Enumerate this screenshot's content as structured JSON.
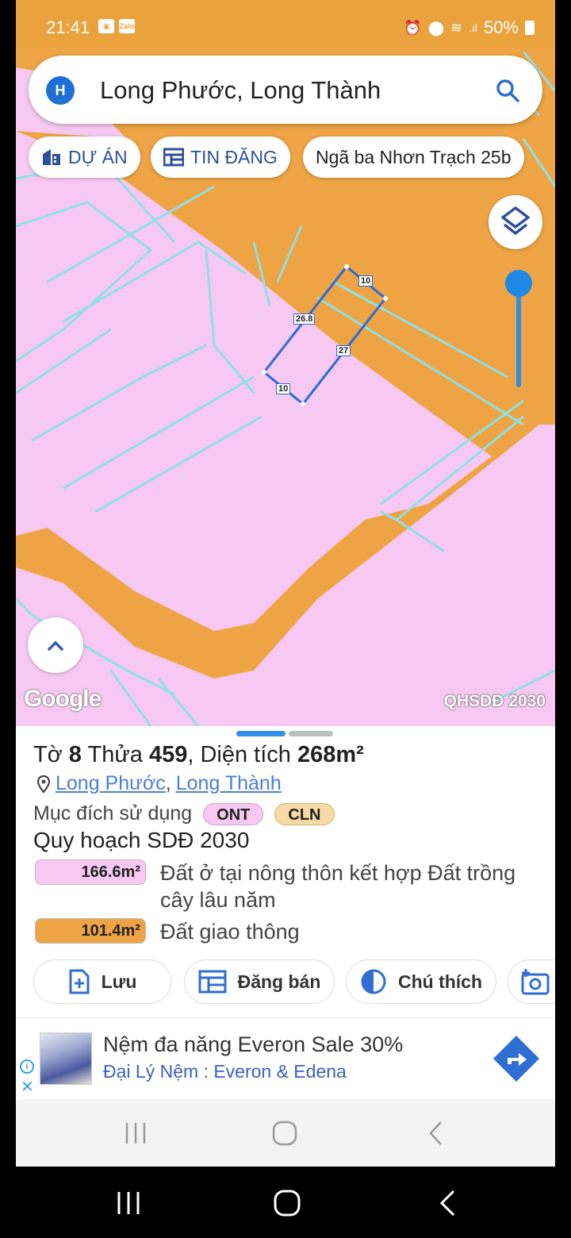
{
  "status_bar": {
    "time": "21:41",
    "battery": "50%",
    "zalo_badge": "Zalo"
  },
  "search": {
    "logo_letter": "H",
    "text": "Long Phước, Long Thành"
  },
  "chips": [
    {
      "label": "DỰ ÁN",
      "icon": "building-icon"
    },
    {
      "label": "TIN ĐĂNG",
      "icon": "listing-icon"
    },
    {
      "label": "Ngã ba Nhơn Trạch 25b"
    }
  ],
  "map": {
    "parcel_dimensions": [
      "10",
      "26.8",
      "27",
      "10"
    ],
    "attribution": "Google",
    "source_label": "QHSDĐ 2030",
    "colors": {
      "residential": "#f7c9f2",
      "transport": "#eea445",
      "boundary": "#8fe0e4",
      "parcel": "#2a6bd6"
    }
  },
  "parcel": {
    "title_prefix": "Tờ",
    "sheet_no": "8",
    "lot_label": "Thửa",
    "lot_no": "459",
    "area_label": ", Diện tích",
    "area": "268m²",
    "address_commune": "Long Phước",
    "address_sep": ",",
    "address_district": "Long Thành",
    "purpose_label": "Mục đích sử dụng",
    "purpose_tags": [
      "ONT",
      "CLN"
    ],
    "plan_title": "Quy hoạch SDĐ 2030",
    "plan_items": [
      {
        "area": "166.6m²",
        "desc": "Đất ở tại nông thôn kết hợp Đất trồng cây lâu năm",
        "color": "#f7c9f2"
      },
      {
        "area": "101.4m²",
        "desc": "Đất giao thông",
        "color": "#eea445"
      }
    ]
  },
  "actions": [
    {
      "label": "Lưu",
      "icon": "save-plus-icon"
    },
    {
      "label": "Đăng bán",
      "icon": "post-listing-icon"
    },
    {
      "label": "Chú thích",
      "icon": "legend-contrast-icon"
    }
  ],
  "ad": {
    "title": "Nệm đa năng Everon Sale 30%",
    "subtitle": "Đại Lý Nệm : Everon & Edena"
  }
}
